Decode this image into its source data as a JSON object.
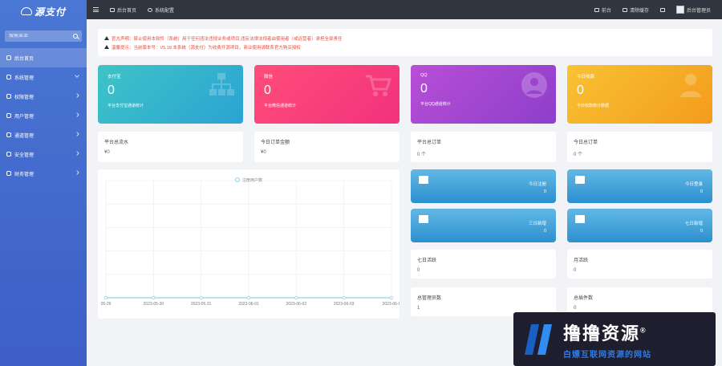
{
  "sidebar": {
    "logo_text": "源支付",
    "search_placeholder": "搜索菜单",
    "items": [
      {
        "label": "后台首页",
        "active": true,
        "arrow": ""
      },
      {
        "label": "系统管理",
        "active": false,
        "arrow": "down"
      },
      {
        "label": "权限管理",
        "active": false,
        "arrow": "right"
      },
      {
        "label": "用户管理",
        "active": false,
        "arrow": "right"
      },
      {
        "label": "通道管理",
        "active": false,
        "arrow": "right"
      },
      {
        "label": "安全管理",
        "active": false,
        "arrow": "right"
      },
      {
        "label": "财务管理",
        "active": false,
        "arrow": "right"
      }
    ]
  },
  "topbar": {
    "tab_home": "后台首页",
    "tab_settings": "系统配置",
    "front": "前台",
    "clear_cache": "清除缓存",
    "fullscreen": "",
    "admin": "后台管理员"
  },
  "notice": {
    "line1": "官方声明：禁止使用本软件（系统）用于任何违法违规业务或项目,违反法律法规者由使用者（或运营者）承担全部责任",
    "line2": "温馨提示：当前版本号：V5.18 本系统（源支付）为收费开源项目，商业使用请联系官方购买授权"
  },
  "cards": [
    {
      "title": "支付宝",
      "value": "0",
      "desc": "平台支付宝通道统计",
      "colors": [
        "#3ec4c7",
        "#2ba3d3"
      ],
      "icon": "sitemap-icon"
    },
    {
      "title": "微信",
      "value": "0",
      "desc": "平台微信通道统计",
      "colors": [
        "#ff4d7a",
        "#f2327c"
      ],
      "icon": "cart-icon"
    },
    {
      "title": "QQ",
      "value": "0",
      "desc": "平台QQ通道统计",
      "colors": [
        "#b84ed6",
        "#8d3fcb"
      ],
      "icon": "user-circle-icon"
    },
    {
      "title": "今日收款",
      "value": "0",
      "desc": "今日收款统计数据",
      "colors": [
        "#f8c233",
        "#f39c1d"
      ],
      "icon": "user-icon"
    }
  ],
  "stats_row1": [
    {
      "label": "平台总流水",
      "value": "¥0"
    },
    {
      "label": "今日订单金额",
      "value": "¥0"
    },
    {
      "label": "平台总订单",
      "value": "0 个"
    },
    {
      "label": "今日总订单",
      "value": "0 个"
    }
  ],
  "tiles": [
    {
      "label": "今日注册",
      "value": "0",
      "icon": "coffee-icon"
    },
    {
      "label": "今日登录",
      "value": "0",
      "icon": "truck-icon"
    },
    {
      "label": "三日新增",
      "value": "0",
      "icon": "cube-icon"
    },
    {
      "label": "七日新增",
      "value": "0",
      "icon": "cart-icon"
    }
  ],
  "stats_row2": [
    {
      "label": "七日活跃",
      "value": "0"
    },
    {
      "label": "月活跃",
      "value": "0"
    }
  ],
  "stats_row3": [
    {
      "label": "总管理员数",
      "value": "1"
    },
    {
      "label": "总插件数",
      "value": "0"
    }
  ],
  "chart_data": {
    "type": "line",
    "series": [
      {
        "name": "注册用户数",
        "values": [
          0,
          0,
          0,
          0,
          0,
          0,
          0
        ]
      }
    ],
    "x": [
      "05-29",
      "2023-05-30",
      "2023-05-31",
      "2023-06-01",
      "2023-06-02",
      "2023-06-03",
      "2023-06-0"
    ],
    "legend": "top-center",
    "grid": true,
    "series_color": "#8fd3e8"
  },
  "watermark": {
    "title": "撸撸资源",
    "subtitle": "白嫖互联网资源的网站",
    "reg": "®"
  }
}
